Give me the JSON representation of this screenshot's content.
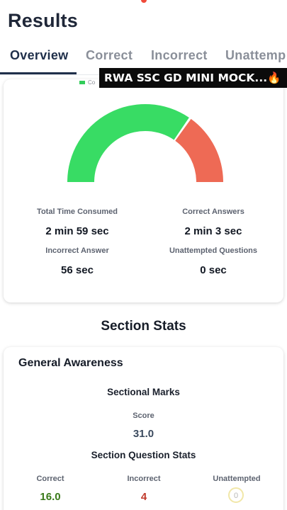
{
  "header": {
    "title": "Results"
  },
  "tabs": [
    {
      "label": "Overview",
      "active": true
    },
    {
      "label": "Correct",
      "active": false
    },
    {
      "label": "Incorrect",
      "active": false
    },
    {
      "label": "Unattemp",
      "active": false
    }
  ],
  "banner": {
    "text": "RWA SSC GD MINI MOCK...🔥"
  },
  "overview": {
    "legend_label": "Co",
    "gauge": {
      "correct_fraction": 0.69,
      "incorrect_fraction": 0.31,
      "colors": {
        "correct": "#38dc64",
        "incorrect": "#ee6a55"
      }
    },
    "stats": [
      {
        "label": "Total Time Consumed",
        "value": "2 min 59 sec"
      },
      {
        "label": "Correct Answers",
        "value": "2 min 3 sec"
      },
      {
        "label": "Incorrect Answer",
        "value": "56 sec"
      },
      {
        "label": "Unattempted Questions",
        "value": "0 sec"
      }
    ]
  },
  "section_stats": {
    "heading": "Section Stats",
    "section": {
      "name": "General Awareness",
      "sectional_marks_label": "Sectional Marks",
      "score_label": "Score",
      "score_value": "31.0",
      "question_stats_label": "Section Question Stats",
      "correct_label": "Correct",
      "correct_value": "16.0",
      "incorrect_label": "Incorrect",
      "incorrect_value": "4",
      "unattempted_label": "Unattempted",
      "unattempted_value": "0"
    }
  }
}
